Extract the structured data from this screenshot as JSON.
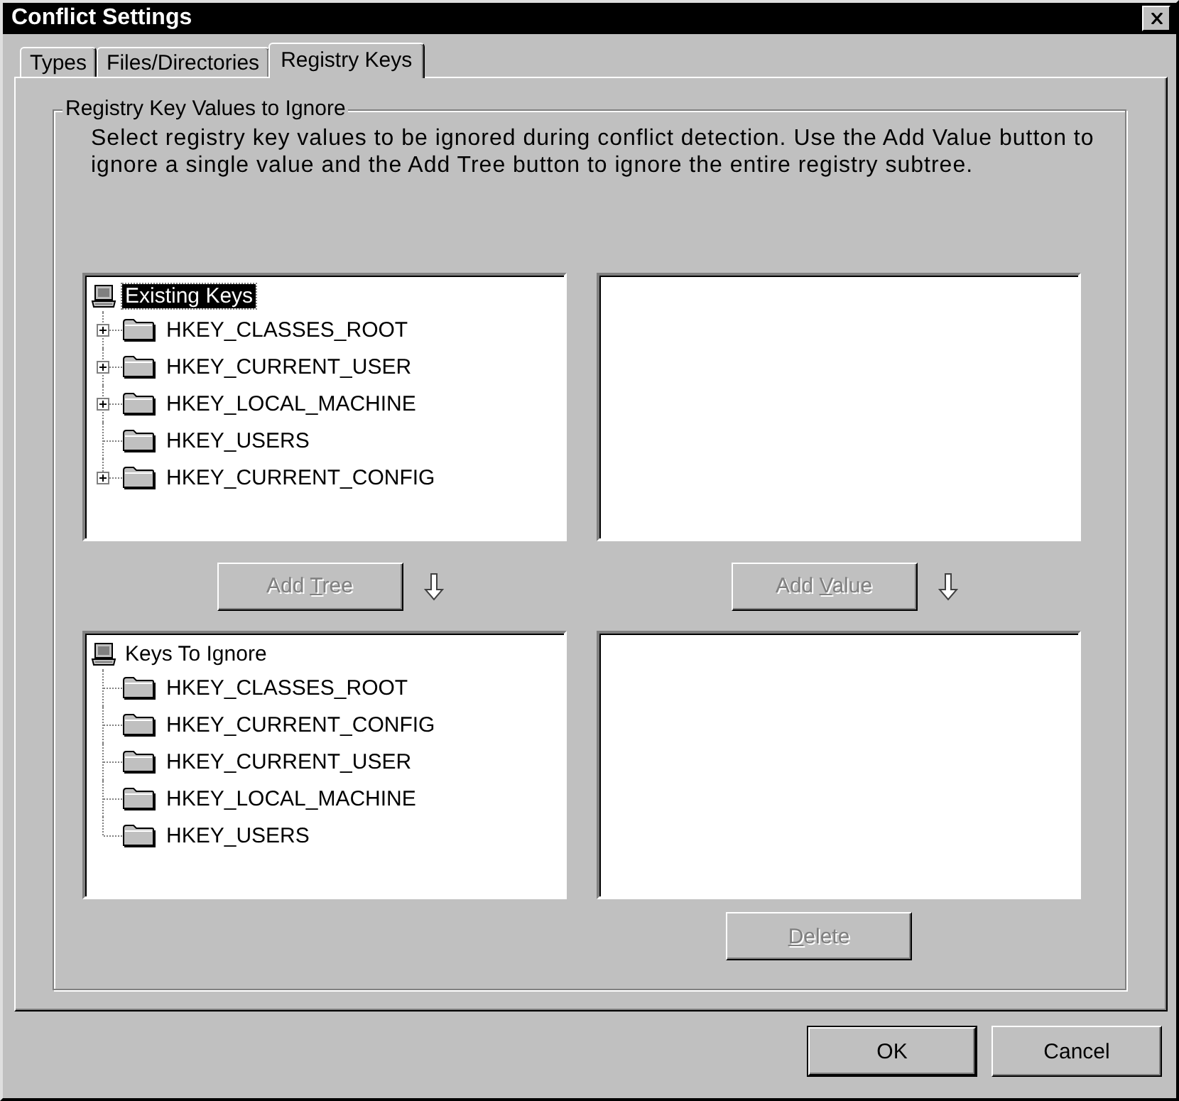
{
  "window": {
    "title": "Conflict Settings"
  },
  "tabs": [
    {
      "label": "Types",
      "selected": false
    },
    {
      "label": "Files/Directories",
      "selected": false
    },
    {
      "label": "Registry Keys",
      "selected": true
    }
  ],
  "group": {
    "title": "Registry Key Values to Ignore",
    "description": "Select registry key values to be ignored during conflict detection. Use the Add Value button to ignore a single value and the Add Tree button to ignore the entire registry subtree."
  },
  "existing_tree": {
    "root": {
      "label": "Existing Keys",
      "selected": true
    },
    "children": [
      {
        "label": "HKEY_CLASSES_ROOT",
        "expandable": true
      },
      {
        "label": "HKEY_CURRENT_USER",
        "expandable": true
      },
      {
        "label": "HKEY_LOCAL_MACHINE",
        "expandable": true
      },
      {
        "label": "HKEY_USERS",
        "expandable": false
      },
      {
        "label": "HKEY_CURRENT_CONFIG",
        "expandable": true
      }
    ]
  },
  "add_tree_button": {
    "label_before": "Add ",
    "access_key": "T",
    "label_after": "ree",
    "disabled": true
  },
  "add_value_button": {
    "label_before": "Add ",
    "access_key": "V",
    "label_after": "alue",
    "disabled": true
  },
  "ignore_tree": {
    "root": {
      "label": "Keys To Ignore",
      "selected": false
    },
    "children": [
      {
        "label": "HKEY_CLASSES_ROOT",
        "expandable": false
      },
      {
        "label": "HKEY_CURRENT_CONFIG",
        "expandable": false
      },
      {
        "label": "HKEY_CURRENT_USER",
        "expandable": false
      },
      {
        "label": "HKEY_LOCAL_MACHINE",
        "expandable": false
      },
      {
        "label": "HKEY_USERS",
        "expandable": false
      }
    ]
  },
  "delete_button": {
    "access_key": "D",
    "label_after": "elete",
    "disabled": true
  },
  "buttons": [
    {
      "label": "OK",
      "default": true
    },
    {
      "label": "Cancel",
      "default": false
    }
  ]
}
